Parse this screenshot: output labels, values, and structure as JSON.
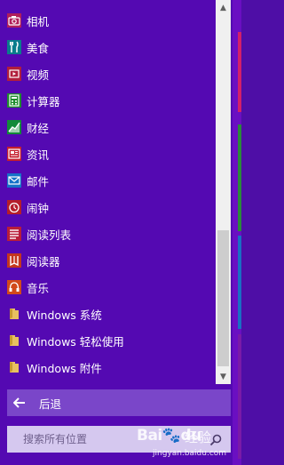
{
  "apps": [
    {
      "label": "相机",
      "icon": "camera-icon",
      "color": "#b01e5a"
    },
    {
      "label": "美食",
      "icon": "food-icon",
      "color": "#0a7d8c"
    },
    {
      "label": "视频",
      "icon": "video-icon",
      "color": "#b11e3c"
    },
    {
      "label": "计算器",
      "icon": "calculator-icon",
      "color": "#1f8c2e"
    },
    {
      "label": "财经",
      "icon": "finance-icon",
      "color": "#128a3a"
    },
    {
      "label": "资讯",
      "icon": "news-icon",
      "color": "#c41e2e"
    },
    {
      "label": "邮件",
      "icon": "mail-icon",
      "color": "#1672c8"
    },
    {
      "label": "闹钟",
      "icon": "alarm-icon",
      "color": "#b51e2a"
    },
    {
      "label": "阅读列表",
      "icon": "reading-list-icon",
      "color": "#b81e3a"
    },
    {
      "label": "阅读器",
      "icon": "reader-icon",
      "color": "#c4361e"
    },
    {
      "label": "音乐",
      "icon": "music-icon",
      "color": "#d24a1a"
    },
    {
      "label": "Windows 系统",
      "icon": "folder-icon",
      "color": "#e8c060"
    },
    {
      "label": "Windows 轻松使用",
      "icon": "folder-icon",
      "color": "#e8c060"
    },
    {
      "label": "Windows 附件",
      "icon": "folder-icon",
      "color": "#e8c060"
    }
  ],
  "back": {
    "label": "后退"
  },
  "search": {
    "placeholder": "搜索所有位置"
  },
  "watermark": {
    "logo": "Bai du",
    "text": "经验",
    "url": "jingyan.baidu.com"
  },
  "colors": {
    "panel": "#5409b2",
    "back_bar": "#7a46c9",
    "search_box": "#d5c8ef"
  }
}
